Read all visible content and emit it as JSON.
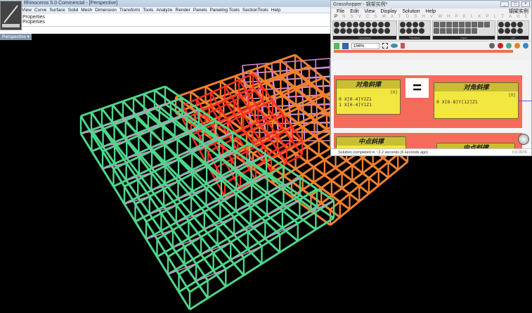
{
  "rhino": {
    "title": "Rhinoceros 5.0 Commercial - [Perspective]",
    "menu": [
      "View",
      "Curve",
      "Surface",
      "Solid",
      "Mesh",
      "Dimension",
      "Transform",
      "Tools",
      "Analyze",
      "Render",
      "Panels",
      "Paneling Tools",
      "SectionTools",
      "Help"
    ],
    "properties": [
      "Properties",
      "Properties"
    ],
    "viewport_tab": "Perspective ▾"
  },
  "gh": {
    "title": "Grasshopper - 钢架实例*",
    "menu": [
      "File",
      "Edit",
      "View",
      "Display",
      "Solution",
      "Help"
    ],
    "menu_right": "钢架实例",
    "tabs": [
      "P",
      "N",
      "S",
      "V",
      "C",
      "S",
      "M",
      "X",
      "T",
      "D",
      "S",
      "H",
      "V",
      "W",
      "H",
      "P",
      "K",
      "L",
      "K",
      "P",
      "L",
      "T",
      "A",
      "H",
      "E"
    ],
    "groups": [
      "Geometry",
      "Primitive",
      "Input",
      "Util"
    ],
    "zoom": "156%",
    "components": [
      {
        "title": "对角斜撑",
        "count": "{0}",
        "lines": [
          "0 X[0-4]Y2Z1",
          "1 X[0-4]Y1Z1"
        ]
      },
      {
        "title": "对角斜撑",
        "count": "{0}",
        "lines": [
          "0 X[6-8]Y[12]Z1"
        ]
      },
      {
        "title": "中点斜撑"
      },
      {
        "title": "中点斜撑"
      }
    ],
    "equals": "=",
    "status": "Solution completed in ~2.2 seconds (6 seconds ago)",
    "version": "0.9.0076"
  },
  "colors": {
    "green": "#4fd68a",
    "pink": "#d68ad6",
    "orange": "#f08030",
    "red": "#ff3020",
    "group": "#f56b5c",
    "comp": "#f2e640"
  }
}
